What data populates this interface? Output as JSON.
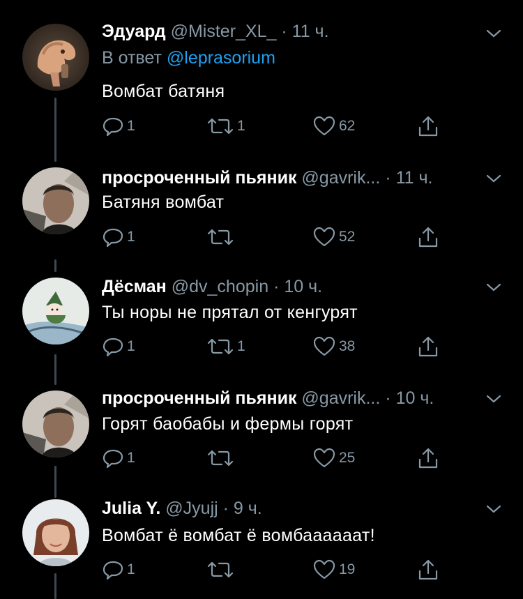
{
  "theme": {
    "background": "#000000",
    "text": "#ffffff",
    "muted": "#8899a6",
    "link": "#1da1f2",
    "thread_line": "#3d4a55"
  },
  "tweets": [
    {
      "name": "Эдуард",
      "handle": "@Mister_XL_",
      "dot": "·",
      "time": "11 ч.",
      "reply_prefix": "В ответ",
      "reply_mention": "@leprasorium",
      "text": "Вомбат батяня",
      "reply_count": "1",
      "retweet_count": "1",
      "like_count": "62",
      "avatar_icon": "dragon-avatar"
    },
    {
      "name": "просроченный пьяник",
      "handle": "@gavrik...",
      "dot": "·",
      "time": "11 ч.",
      "text": "Батяня вомбат",
      "reply_count": "1",
      "retweet_count": "",
      "like_count": "52",
      "avatar_icon": "man-avatar"
    },
    {
      "name": "Дёсман",
      "handle": "@dv_chopin",
      "dot": "·",
      "time": "10 ч.",
      "text": "Ты норы не прятал от кенгурят",
      "reply_count": "1",
      "retweet_count": "1",
      "like_count": "38",
      "avatar_icon": "cartoon-avatar"
    },
    {
      "name": "просроченный пьяник",
      "handle": "@gavrik...",
      "dot": "·",
      "time": "10 ч.",
      "text": "Горят баобабы и фермы горят",
      "reply_count": "1",
      "retweet_count": "",
      "like_count": "25",
      "avatar_icon": "man-avatar"
    },
    {
      "name": "Julia Y.",
      "handle": "@Jyujj",
      "dot": "·",
      "time": "9 ч.",
      "text": "Вомбат ё вомбат ё вомбаааааат!",
      "reply_count": "1",
      "retweet_count": "",
      "like_count": "19",
      "avatar_icon": "woman-avatar"
    }
  ]
}
